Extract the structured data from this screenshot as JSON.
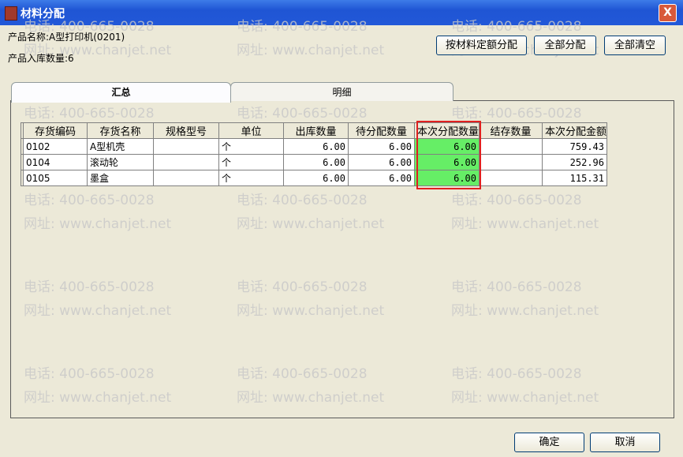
{
  "window": {
    "title": "材料分配",
    "close": "X"
  },
  "watermark": {
    "phone": "电话: 400-665-0028",
    "site": "网址: www.chanjet.net"
  },
  "product": {
    "name_label": "产品名称:A型打印机(0201)",
    "qty_label": "产品入库数量:6"
  },
  "toolbar": {
    "by_quota": "按材料定额分配",
    "allocate_all": "全部分配",
    "clear_all": "全部清空"
  },
  "tabs": [
    {
      "label": "汇总",
      "active": true
    },
    {
      "label": "明细",
      "active": false
    }
  ],
  "grid": {
    "columns": [
      "存货编码",
      "存货名称",
      "规格型号",
      "单位",
      "出库数量",
      "待分配数量",
      "本次分配数量",
      "结存数量",
      "本次分配金额"
    ],
    "rows": [
      [
        "0102",
        "A型机壳",
        "",
        "个",
        "6.00",
        "6.00",
        "6.00",
        "",
        "759.43"
      ],
      [
        "0104",
        "滚动轮",
        "",
        "个",
        "6.00",
        "6.00",
        "6.00",
        "",
        "252.96"
      ],
      [
        "0105",
        "墨盒",
        "",
        "个",
        "6.00",
        "6.00",
        "6.00",
        "",
        "115.31"
      ]
    ],
    "highlight_color": "#66ee66",
    "highlight_column": "本次分配数量"
  },
  "footer": {
    "ok": "确定",
    "cancel": "取消"
  }
}
